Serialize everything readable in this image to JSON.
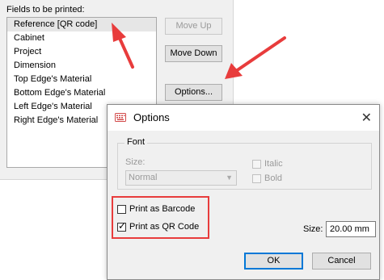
{
  "main_panel": {
    "fields_label": "Fields to be printed:",
    "fields": [
      "Reference [QR code]",
      "Cabinet",
      "Project",
      "Dimension",
      "Top Edge's Material",
      "Bottom Edge's Material",
      "Left Edge's Material",
      "Right Edge's Material"
    ],
    "buttons": {
      "move_up": "Move Up",
      "move_down": "Move Down",
      "options": "Options..."
    }
  },
  "options_dialog": {
    "title": "Options",
    "close_symbol": "✕",
    "font_group": {
      "legend": "Font",
      "size_label": "Size:",
      "size_value": "Normal",
      "italic_label": "Italic",
      "bold_label": "Bold"
    },
    "print_barcode_label": "Print as Barcode",
    "print_qrcode_label": "Print as QR Code",
    "print_barcode_checked": false,
    "print_qrcode_checked": true,
    "size_label": "Size:",
    "size_value": "20.00 mm",
    "ok_label": "OK",
    "cancel_label": "Cancel"
  },
  "annotations": {
    "arrow_color": "#e83c3c"
  }
}
